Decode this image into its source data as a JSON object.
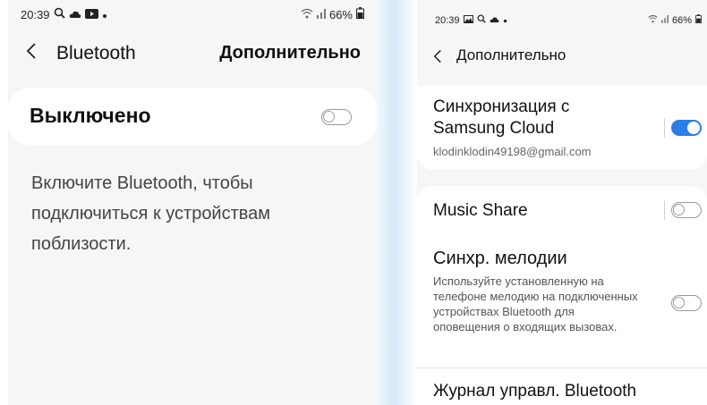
{
  "left": {
    "status": {
      "time": "20:39",
      "battery": "66%"
    },
    "header": {
      "title": "Bluetooth",
      "more": "Дополнительно"
    },
    "bt_toggle": {
      "label": "Выключено",
      "state": "off"
    },
    "hint": "Включите Bluetooth, чтобы подключиться к устройствам поблизости."
  },
  "right": {
    "status": {
      "time": "20:39",
      "battery": "66%"
    },
    "header": {
      "title": "Дополнительно"
    },
    "sync": {
      "title": "Синхронизация с Samsung Cloud",
      "account": "klodinklodin49198@gmail.com",
      "state": "on"
    },
    "music_share": {
      "title": "Music Share",
      "state": "off"
    },
    "ringtone_sync": {
      "title": "Синхр. мелодии",
      "description": "Используйте установленную на телефоне мелодию на подключенных устройствах Bluetooth для оповещения о входящих вызовах.",
      "state": "off"
    },
    "control_log": {
      "title": "Журнал управл. Bluetooth"
    }
  },
  "colors": {
    "accent": "#2a7ee6",
    "panel_bg": "#f6f6f6",
    "card_bg": "#ffffff"
  }
}
